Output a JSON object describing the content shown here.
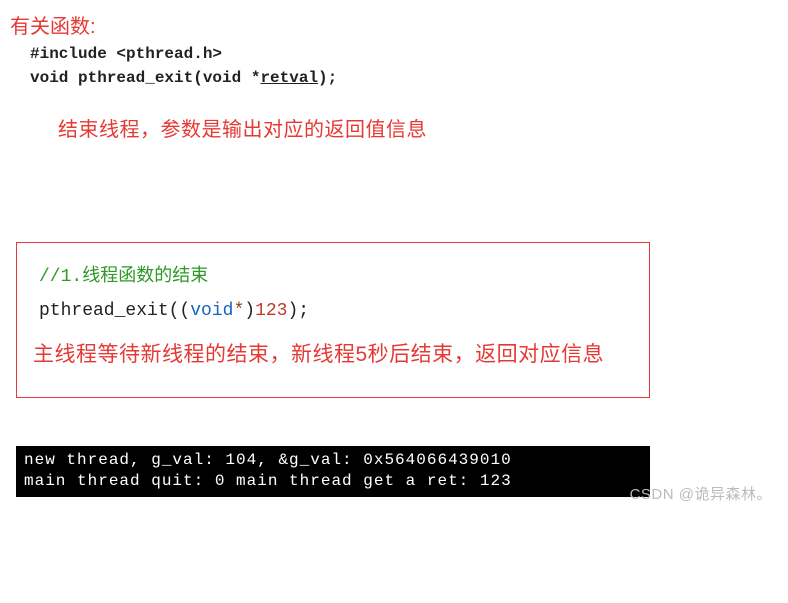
{
  "heading": "有关函数:",
  "include_line": "#include <pthread.h>",
  "proto_pre": "void pthread_exit(void *",
  "proto_param": "retval",
  "proto_post": ");",
  "desc1": "结束线程，参数是输出对应的返回值信息",
  "codebox": {
    "comment_raw": "//1.线程函数的结束",
    "stmt_pre": "pthread_exit((",
    "kw": "void",
    "star": "*",
    "mid": ")",
    "num": "123",
    "post": ");",
    "box_desc": "主线程等待新线程的结束，新线程5秒后结束，返回对应信息"
  },
  "terminal_line1": "new thread, g_val: 104, &g_val: 0x564066439010",
  "terminal_line2": "main thread quit: 0 main thread get a ret: 123",
  "watermark": "CSDN @诡异森林。"
}
